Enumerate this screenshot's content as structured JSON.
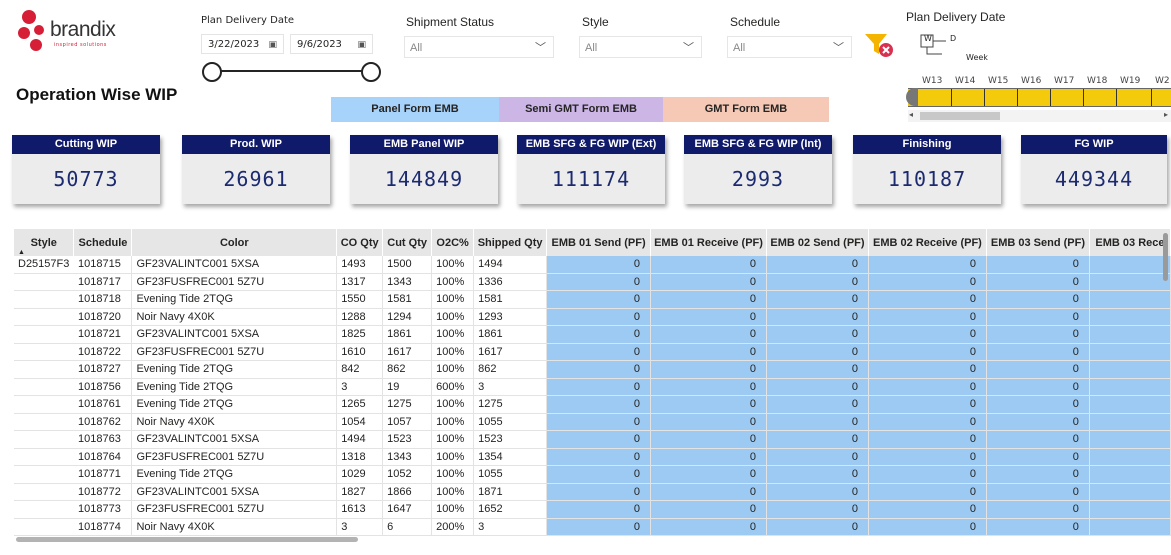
{
  "logo": {
    "brand": "brandix",
    "tagline": "inspired solutions"
  },
  "date_slicer": {
    "title": "Plan Delivery Date",
    "start": "3/22/2023",
    "end": "9/6/2023"
  },
  "filters": [
    {
      "title": "Shipment Status",
      "value": "All"
    },
    {
      "title": "Style",
      "value": "All"
    },
    {
      "title": "Schedule",
      "value": "All"
    }
  ],
  "week_slicer": {
    "title": "Plan Delivery Date",
    "hierarchy_top": "W",
    "hierarchy_bottom": "D",
    "level_label": "Week",
    "weeks": [
      "W13",
      "W14",
      "W15",
      "W16",
      "W17",
      "W18",
      "W19",
      "W2"
    ],
    "bar_color": "#f3ca0c"
  },
  "page_title": "Operation Wise WIP",
  "tabs": [
    {
      "label": "Panel Form EMB",
      "color": "#a7d2fa"
    },
    {
      "label": "Semi GMT Form EMB",
      "color": "#cbb6e6"
    },
    {
      "label": "GMT Form EMB",
      "color": "#f5c9b6"
    }
  ],
  "kpis": [
    {
      "label": "Cutting WIP",
      "value": "50773"
    },
    {
      "label": "Prod. WIP",
      "value": "26961"
    },
    {
      "label": "EMB Panel WIP",
      "value": "144849"
    },
    {
      "label": "EMB SFG & FG WIP (Ext)",
      "value": "111174"
    },
    {
      "label": "EMB SFG & FG WIP (Int)",
      "value": "2993"
    },
    {
      "label": "Finishing",
      "value": "110187"
    },
    {
      "label": "FG WIP",
      "value": "449344"
    }
  ],
  "table": {
    "columns": [
      "Style",
      "Schedule",
      "Color",
      "CO Qty",
      "Cut Qty",
      "O2C%",
      "Shipped Qty",
      "EMB 01 Send (PF)",
      "EMB 01 Receive (PF)",
      "EMB 02 Send (PF)",
      "EMB 02 Receive (PF)",
      "EMB 03 Send (PF)",
      "EMB 03 Rece"
    ],
    "sort_indicator": "▲",
    "accent": "#9ccaf2",
    "rows": [
      [
        "D25157F3",
        "1018715",
        "GF23VALINTC001 5XSA",
        "1493",
        "1500",
        "100%",
        "1494",
        "0",
        "0",
        "0",
        "0",
        "0",
        ""
      ],
      [
        "",
        "1018717",
        "GF23FUSFREC001 5Z7U",
        "1317",
        "1343",
        "100%",
        "1336",
        "0",
        "0",
        "0",
        "0",
        "0",
        ""
      ],
      [
        "",
        "1018718",
        "Evening Tide 2TQG",
        "1550",
        "1581",
        "100%",
        "1581",
        "0",
        "0",
        "0",
        "0",
        "0",
        ""
      ],
      [
        "",
        "1018720",
        "Noir Navy 4X0K",
        "1288",
        "1294",
        "100%",
        "1293",
        "0",
        "0",
        "0",
        "0",
        "0",
        ""
      ],
      [
        "",
        "1018721",
        "GF23VALINTC001 5XSA",
        "1825",
        "1861",
        "100%",
        "1861",
        "0",
        "0",
        "0",
        "0",
        "0",
        ""
      ],
      [
        "",
        "1018722",
        "GF23FUSFREC001 5Z7U",
        "1610",
        "1617",
        "100%",
        "1617",
        "0",
        "0",
        "0",
        "0",
        "0",
        ""
      ],
      [
        "",
        "1018727",
        "Evening Tide 2TQG",
        "842",
        "862",
        "100%",
        "862",
        "0",
        "0",
        "0",
        "0",
        "0",
        ""
      ],
      [
        "",
        "1018756",
        "Evening Tide 2TQG",
        "3",
        "19",
        "600%",
        "3",
        "0",
        "0",
        "0",
        "0",
        "0",
        ""
      ],
      [
        "",
        "1018761",
        "Evening Tide 2TQG",
        "1265",
        "1275",
        "100%",
        "1275",
        "0",
        "0",
        "0",
        "0",
        "0",
        ""
      ],
      [
        "",
        "1018762",
        "Noir Navy 4X0K",
        "1054",
        "1057",
        "100%",
        "1055",
        "0",
        "0",
        "0",
        "0",
        "0",
        ""
      ],
      [
        "",
        "1018763",
        "GF23VALINTC001 5XSA",
        "1494",
        "1523",
        "100%",
        "1523",
        "0",
        "0",
        "0",
        "0",
        "0",
        ""
      ],
      [
        "",
        "1018764",
        "GF23FUSFREC001 5Z7U",
        "1318",
        "1343",
        "100%",
        "1354",
        "0",
        "0",
        "0",
        "0",
        "0",
        ""
      ],
      [
        "",
        "1018771",
        "Evening Tide 2TQG",
        "1029",
        "1052",
        "100%",
        "1055",
        "0",
        "0",
        "0",
        "0",
        "0",
        ""
      ],
      [
        "",
        "1018772",
        "GF23VALINTC001 5XSA",
        "1827",
        "1866",
        "100%",
        "1871",
        "0",
        "0",
        "0",
        "0",
        "0",
        ""
      ],
      [
        "",
        "1018773",
        "GF23FUSFREC001 5Z7U",
        "1613",
        "1647",
        "100%",
        "1652",
        "0",
        "0",
        "0",
        "0",
        "0",
        ""
      ],
      [
        "",
        "1018774",
        "Noir Navy 4X0K",
        "3",
        "6",
        "200%",
        "3",
        "0",
        "0",
        "0",
        "0",
        "0",
        ""
      ]
    ]
  }
}
